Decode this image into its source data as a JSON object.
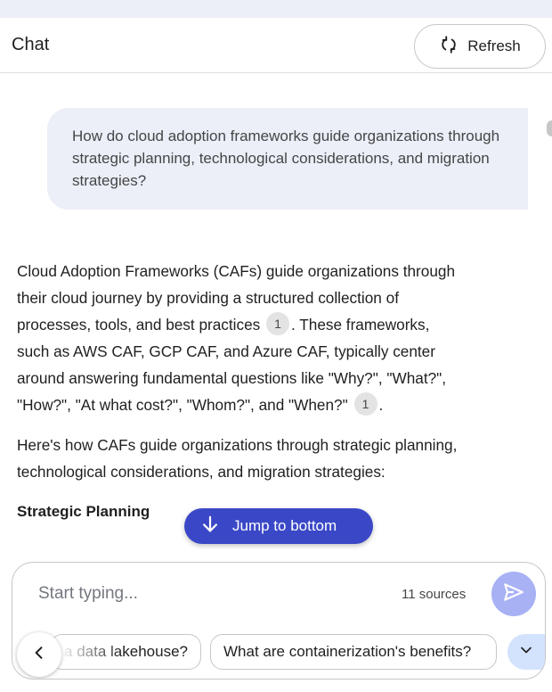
{
  "header": {
    "title": "Chat",
    "refresh_label": "Refresh"
  },
  "conversation": {
    "user_message": "How do cloud adoption frameworks guide organizations through strategic planning, technological considerations, and migration strategies?",
    "answer": {
      "p1_part1": "Cloud Adoption Frameworks (CAFs) guide organizations through their cloud journey by providing a structured collection of processes, tools, and best practices",
      "p1_cite1": "1",
      "p1_part2": ". These frameworks, such as AWS CAF, GCP CAF, and Azure CAF, typically center around answering fundamental questions like \"Why?\", \"What?\", \"How?\", \"At what cost?\", \"Whom?\", and \"When?\"",
      "p1_cite2": "1",
      "p1_part3": ".",
      "p2": "Here's how CAFs guide organizations through strategic planning, technological considerations, and migration strategies:",
      "heading": "Strategic Planning"
    }
  },
  "jump_button": {
    "label": "Jump to bottom"
  },
  "composer": {
    "placeholder": "Start typing...",
    "sources": "11 sources"
  },
  "suggestions": [
    "a data lakehouse?",
    "What are containerization's benefits?"
  ],
  "colors": {
    "accent": "#3a48c7",
    "send_button": "#a8b1f4",
    "user_bubble": "#eceef8"
  }
}
